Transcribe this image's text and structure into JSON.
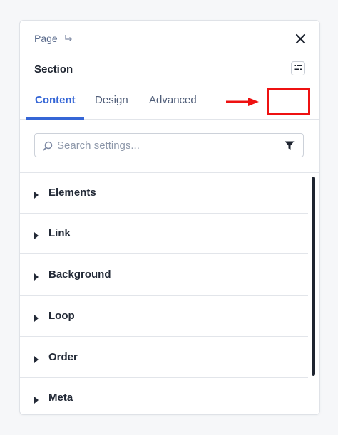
{
  "header": {
    "breadcrumb": "Page",
    "title": "Section"
  },
  "icons": {
    "breadcrumb": "return-arrow-icon",
    "close": "close-icon",
    "layout": "layout-toggle-icon",
    "search": "search-icon",
    "filter": "filter-icon",
    "caret": "caret-right-icon"
  },
  "tabs": [
    {
      "label": "Content",
      "active": true
    },
    {
      "label": "Design",
      "active": false
    },
    {
      "label": "Advanced",
      "active": false
    }
  ],
  "search": {
    "placeholder": "Search settings..."
  },
  "sections": [
    {
      "label": "Elements"
    },
    {
      "label": "Link"
    },
    {
      "label": "Background"
    },
    {
      "label": "Loop"
    },
    {
      "label": "Order"
    },
    {
      "label": "Meta"
    }
  ],
  "colors": {
    "accent": "#3566d6",
    "annotation": "#ee1111"
  }
}
